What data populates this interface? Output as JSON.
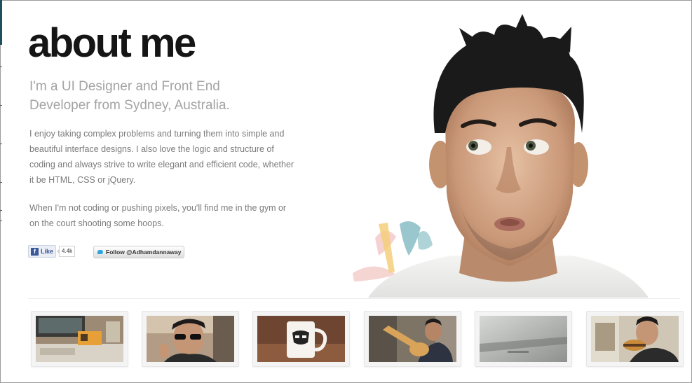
{
  "title": "about me",
  "subtitle": "I'm a UI Designer and Front End Developer from Sydney, Australia.",
  "paragraphs": [
    "I enjoy taking complex problems and turning them into simple and beautiful interface designs. I also love the logic and structure of coding and always strive to write elegant and efficient code, whether it be HTML, CSS or jQuery.",
    "When I'm not coding or pushing pixels, you'll find me in the gym or on the court shooting some hoops."
  ],
  "social": {
    "facebook_like_label": "Like",
    "facebook_count": "4.4k",
    "twitter_follow_label": "Follow @Adhamdannaway",
    "facebook_icon": "facebook-icon",
    "twitter_icon": "twitter-bird-icon"
  },
  "gallery": {
    "thumbnails": [
      {
        "subject": "desk-with-monitor-and-toys"
      },
      {
        "subject": "man-with-sunglasses"
      },
      {
        "subject": "stormtrooper-mug"
      },
      {
        "subject": "man-playing-guitar"
      },
      {
        "subject": "macbook-closeup"
      },
      {
        "subject": "man-eating-burger"
      }
    ]
  },
  "colors": {
    "title": "#151515",
    "subtitle": "#a3a3a3",
    "body_text": "#7b7b7b",
    "facebook_blue": "#3b5998",
    "twitter_blue": "#2ea5dd"
  }
}
